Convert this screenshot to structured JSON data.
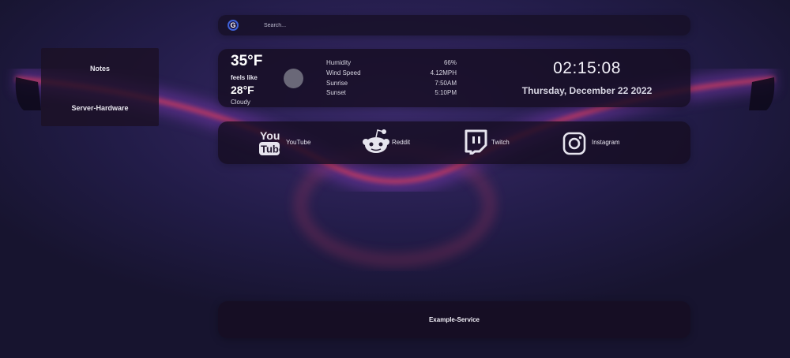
{
  "sidebar": {
    "items": [
      {
        "label": "Notes"
      },
      {
        "label": "Server-Hardware"
      }
    ]
  },
  "search": {
    "engine_icon": "google-g-icon",
    "engine_letter": "G",
    "placeholder": "Search..."
  },
  "weather": {
    "temperature": "35°F",
    "feels_like_label": "feels like",
    "feels_like_value": "28°F",
    "condition": "Cloudy",
    "icon": "moon-icon",
    "details": [
      {
        "label": "Humidity",
        "value": "66%"
      },
      {
        "label": "Wind Speed",
        "value": "4.12MPH"
      },
      {
        "label": "Sunrise",
        "value": "7:50AM"
      },
      {
        "label": "Sunset",
        "value": "5:10PM"
      }
    ]
  },
  "clock": {
    "time": "02:15:08",
    "date": "Thursday, December 22 2022"
  },
  "links": [
    {
      "label": "YouTube",
      "icon": "youtube-icon"
    },
    {
      "label": "Reddit",
      "icon": "reddit-icon"
    },
    {
      "label": "Twitch",
      "icon": "twitch-icon"
    },
    {
      "label": "Instagram",
      "icon": "instagram-icon"
    }
  ],
  "services": [
    {
      "label": "Example-Service"
    }
  ],
  "colors": {
    "background": "#1c1838",
    "panel": "#160e22",
    "glow_red": "#d23a5a",
    "glow_purple": "#6e3aa0",
    "text": "#e6e4ee"
  }
}
